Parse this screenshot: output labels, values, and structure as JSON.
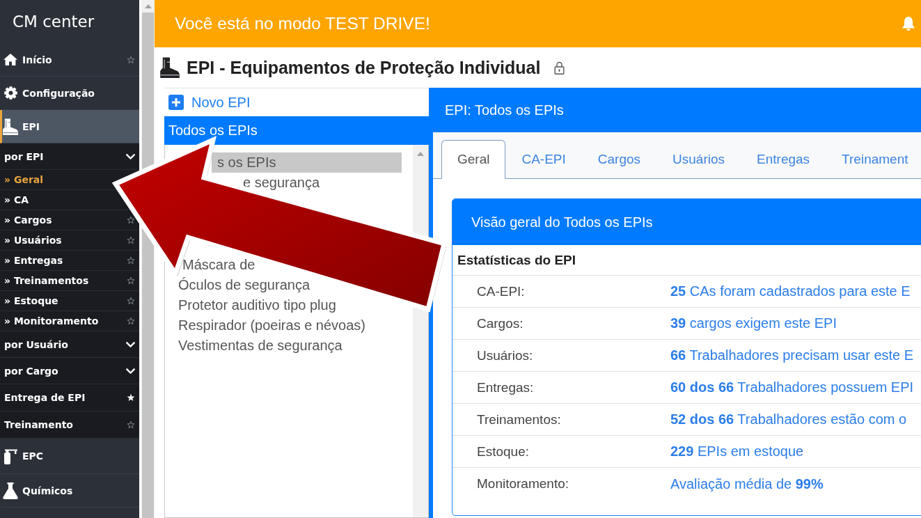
{
  "sidebar": {
    "title": "CM center",
    "items": [
      {
        "label": "Início",
        "selected": false,
        "starred": false
      },
      {
        "label": "Configuração",
        "selected": false
      },
      {
        "label": "EPI",
        "selected": true,
        "children": [
          {
            "kind": "group",
            "label": "por EPI",
            "expanded": true,
            "children": [
              {
                "label": "» Geral",
                "selected": true
              },
              {
                "label": "» CA",
                "selected": false
              },
              {
                "label": "» Cargos",
                "selected": false,
                "starred": false
              },
              {
                "label": "» Usuários",
                "selected": false,
                "starred": false
              },
              {
                "label": "» Entregas",
                "selected": false,
                "starred": false
              },
              {
                "label": "» Treinamentos",
                "selected": false,
                "starred": false
              },
              {
                "label": "» Estoque",
                "selected": false,
                "starred": false
              },
              {
                "label": "» Monitoramento",
                "selected": false,
                "starred": false
              }
            ]
          },
          {
            "kind": "group",
            "label": "por Usuário",
            "expanded": false
          },
          {
            "kind": "group",
            "label": "por Cargo",
            "expanded": false
          },
          {
            "kind": "link",
            "label": "Entrega de EPI",
            "starred": true
          },
          {
            "kind": "link",
            "label": "Treinamento",
            "starred": false
          }
        ]
      },
      {
        "label": "EPC",
        "selected": false
      },
      {
        "label": "Químicos",
        "selected": false
      }
    ]
  },
  "banner": {
    "text": "Você está no modo TEST DRIVE!"
  },
  "page": {
    "title": "EPI - Equipamentos de Proteção Individual"
  },
  "list_panel": {
    "new_button": "Novo EPI",
    "header": "Todos os EPIs",
    "items": [
      {
        "label": "s os EPIs",
        "selected": true
      },
      {
        "label": "e segurança",
        "selected": false
      },
      {
        "label": "Máscara de",
        "selected": false
      },
      {
        "label": "Óculos de segurança",
        "selected": false
      },
      {
        "label": "Protetor auditivo tipo plug",
        "selected": false
      },
      {
        "label": "Respirador (poeiras e névoas)",
        "selected": false
      },
      {
        "label": "Vestimentas de segurança",
        "selected": false
      }
    ]
  },
  "detail_panel": {
    "header": "EPI: Todos os EPIs",
    "tabs": [
      {
        "label": "Geral",
        "selected": true
      },
      {
        "label": "CA-EPI",
        "selected": false
      },
      {
        "label": "Cargos",
        "selected": false
      },
      {
        "label": "Usuários",
        "selected": false
      },
      {
        "label": "Entregas",
        "selected": false
      },
      {
        "label": "Treinament",
        "selected": false
      }
    ],
    "card": {
      "title": "Visão geral do Todos os EPIs",
      "section": "Estatísticas do EPI",
      "rows": [
        {
          "label": "CA-EPI:",
          "value": "**25** CAs foram cadastrados para este E"
        },
        {
          "label": "Cargos:",
          "value": "**39** cargos exigem este EPI"
        },
        {
          "label": "Usuários:",
          "value": "**66** Trabalhadores precisam usar este E"
        },
        {
          "label": "Entregas:",
          "value": "**60 dos 66** Trabalhadores possuem EPI"
        },
        {
          "label": "Treinamentos:",
          "value": "**52 dos 66** Trabalhadores estão com o"
        },
        {
          "label": "Estoque:",
          "value": "**229** EPIs em estoque"
        },
        {
          "label": "Monitoramento:",
          "value": "Avaliação média de **99%**"
        }
      ]
    }
  }
}
